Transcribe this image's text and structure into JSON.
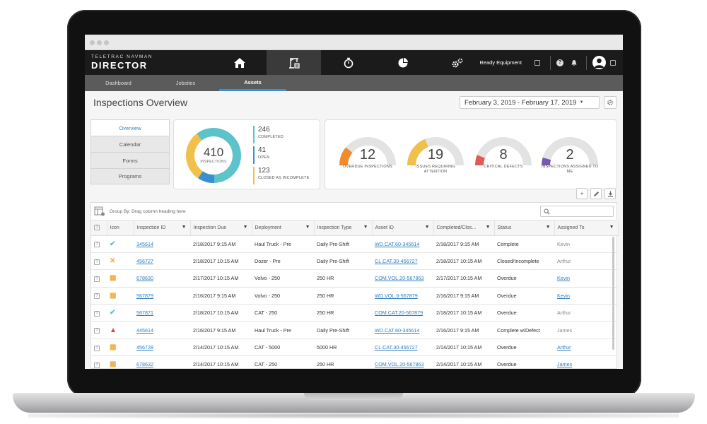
{
  "brand": {
    "top": "TELETRAC NAVMAN",
    "main": "DIRECTOR"
  },
  "topnav": {
    "icons": [
      "home-icon",
      "crane-icon",
      "stopwatch-icon",
      "pie-chart-icon",
      "gears-icon"
    ],
    "active_icon": "crane-icon",
    "account": "Ready Equipment",
    "help": "?"
  },
  "subnav": {
    "tabs": [
      "Dashboard",
      "Jobsites",
      "Assets"
    ],
    "active": "Assets"
  },
  "page": {
    "title": "Inspections Overview",
    "date_range": "February 3, 2019 - February 17, 2019"
  },
  "side_menu": [
    "Overview",
    "Calendar",
    "Forms",
    "Programs"
  ],
  "summary": {
    "total": "410",
    "total_label": "INSPECTIONS",
    "completed": {
      "value": "246",
      "label": "COMPLETED",
      "color": "#5bc3c9"
    },
    "open": {
      "value": "41",
      "label": "OPEN",
      "color": "#3a8fd1"
    },
    "incomplete": {
      "value": "123",
      "label": "CLOSED AS INCOMPLETE",
      "color": "#f0c04a"
    }
  },
  "status_cards": [
    {
      "value": "12",
      "label": "OVERDUE INSPECTIONS",
      "color": "#f08c2c",
      "fraction": 0.22
    },
    {
      "value": "19",
      "label": "ISSUES REQUIRING ATTENTION",
      "color": "#f0c04a",
      "fraction": 0.38
    },
    {
      "value": "8",
      "label": "CRITICAL DEFECTS",
      "color": "#e05a5a",
      "fraction": 0.12
    },
    {
      "value": "2",
      "label": "INSPECTIONS ASSIGNED TO ME",
      "color": "#7a59b5",
      "fraction": 0.09
    }
  ],
  "table": {
    "group_text": "Group By: Drag column heading here",
    "columns": [
      "Icon",
      "Inspection ID",
      "Inspection Due",
      "Deployment",
      "Inspection Type",
      "Asset ID",
      "Completed/Clos...",
      "Status",
      "Assigned To"
    ],
    "rows": [
      {
        "icon": "check",
        "id": "345614",
        "due": "2/18/2017   9:15 AM",
        "deployment": "Haul Truck - Pre",
        "type": "Daily Pre-Shift",
        "asset": "WD.CAT.60-345614",
        "completed": "2/18/2017   9:15 AM",
        "status": "Complete",
        "assigned": "Kevin",
        "assigned_link": false
      },
      {
        "icon": "x",
        "id": "456727",
        "due": "2/18/2017   10:15 AM",
        "deployment": "Dozer - Pre",
        "type": "Daily Pre-Shift",
        "asset": "CL.CAT.30-456727",
        "completed": "2/18/2017   10:15 AM",
        "status": "Closed/Incomplete",
        "assigned": "Arthur",
        "assigned_link": false
      },
      {
        "icon": "calendar",
        "id": "678630",
        "due": "2/17/2017   10:15 AM",
        "deployment": "Volvo - 250",
        "type": "250 HR",
        "asset": "COM.VOL.20-567863",
        "completed": "2/17/2017   10:15 AM",
        "status": "Overdue",
        "assigned": "Kevin",
        "assigned_link": true
      },
      {
        "icon": "calendar",
        "id": "567879",
        "due": "2/16/2017   9:15 AM",
        "deployment": "Volvo - 250",
        "type": "250 HR",
        "asset": "WD.VOL.6-567879",
        "completed": "2/16/2017   9:15 AM",
        "status": "Overdue",
        "assigned": "Kevin",
        "assigned_link": true
      },
      {
        "icon": "check",
        "id": "567871",
        "due": "2/18/2017   10:15 AM",
        "deployment": "CAT - 250",
        "type": "250 HR",
        "asset": "COM.CAT.20-567879",
        "completed": "2/18/2017   10:15 AM",
        "status": "Overdue",
        "assigned": "Arthur",
        "assigned_link": false
      },
      {
        "icon": "warning",
        "id": "445614",
        "due": "2/16/2017   9:15 AM",
        "deployment": "Haul Truck - Pre",
        "type": "Daily Pre-Shift",
        "asset": "WD.CAT.60-345614",
        "completed": "2/16/2017   9:15 AM",
        "status": "Complete w/Defect",
        "assigned": "James",
        "assigned_link": false
      },
      {
        "icon": "calendar",
        "id": "456728",
        "due": "2/14/2017   10:15 AM",
        "deployment": "CAT - 5000",
        "type": "5000 HR",
        "asset": "CL.CAT.30-456727",
        "completed": "2/14/2017   10:15 AM",
        "status": "Overdue",
        "assigned": "Arthur",
        "assigned_link": true
      },
      {
        "icon": "calendar",
        "id": "678632",
        "due": "2/14/2017   10:15 AM",
        "deployment": "CAT - 250",
        "type": "250 HR",
        "asset": "COM.VOL.20-567863",
        "completed": "2/14/2017   10:15 AM",
        "status": "Overdue",
        "assigned": "James",
        "assigned_link": true
      }
    ]
  }
}
